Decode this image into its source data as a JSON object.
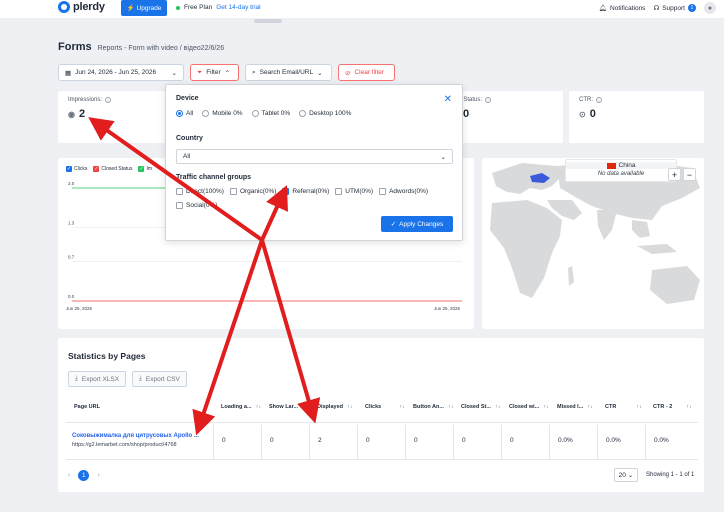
{
  "brand": {
    "name": "plerdy",
    "color": "#1a73e8"
  },
  "topbar": {
    "upgrade_label": "Upgrade",
    "plan_label": "Free Plan",
    "trial_link": "Get 14-day trial",
    "notifications_label": "Notifications",
    "support_label": "Support",
    "support_badge": "1"
  },
  "header": {
    "title": "Forms",
    "breadcrumb": "Reports - Form with video / відео22/6/26"
  },
  "controls": {
    "date_range": "Jun 24, 2026 - Jun 25, 2026",
    "filter_label": "Filter",
    "search_label": "Search Email/URL",
    "clear_filter_label": "Clear filter"
  },
  "stats": {
    "impressions_label": "Impressions:",
    "impressions_value": "2",
    "closed_status_label": "ed Status:",
    "closed_status_value": "0",
    "ctr_label": "CTR:",
    "ctr_value": "0"
  },
  "line_chart": {
    "legend": [
      {
        "label": "Clicks",
        "color": "#1a73e8"
      },
      {
        "label": "Closed Status",
        "color": "#ef4444"
      },
      {
        "label": "Im",
        "color": "#22c55e"
      }
    ]
  },
  "chart_data": {
    "type": "line",
    "x": [
      "Jun 25, 2026",
      "Jun 25, 2026"
    ],
    "ylim": [
      0,
      2.0
    ],
    "yticks": [
      "2.0",
      "1.3",
      "0.7",
      "0.0"
    ],
    "series": [
      {
        "name": "Impressions",
        "color": "#22c55e",
        "values": [
          2,
          2
        ]
      },
      {
        "name": "Closed Status",
        "color": "#ef4444",
        "values": [
          0,
          0
        ]
      }
    ]
  },
  "map": {
    "country": "China",
    "no_data": "No data available",
    "zoom_in": "+",
    "zoom_out": "−"
  },
  "stats_table": {
    "title": "Statistics by Pages",
    "export_xlsx": "Export XLSX",
    "export_csv": "Export CSV",
    "columns": [
      "Page URL",
      "Loading a...",
      "Show Lar...",
      "Displayed",
      "Clicks",
      "Button An...",
      "Closed St...",
      "Closed wi...",
      "Missed I...",
      "CTR",
      "CTR - 2"
    ],
    "rows": [
      {
        "page_title": "Соковыжималка для цитрусовых Apollo ...",
        "page_url": "https://g2.lemarbet.com/shop/product/4768",
        "values": [
          "0",
          "0",
          "2",
          "0",
          "0",
          "0",
          "0",
          "0.0%",
          "0.0%",
          "0.0%"
        ]
      }
    ],
    "current_page": "1",
    "per_page": "20",
    "showing": "Showing 1 - 1 of 1"
  },
  "filter_popup": {
    "device_heading": "Device",
    "device_options": [
      "All",
      "Mobile 0%",
      "Tablet 0%",
      "Desktop 100%"
    ],
    "device_selected": "All",
    "country_heading": "Country",
    "country_value": "All",
    "traffic_heading": "Traffic channel groups",
    "traffic_row1": [
      {
        "label": "Direct(100%)",
        "checked": false
      },
      {
        "label": "Organic(0%)",
        "checked": false
      },
      {
        "label": "Referral(0%)",
        "checked": true
      },
      {
        "label": "UTM(0%)",
        "checked": false
      },
      {
        "label": "Adwords(0%)",
        "checked": false
      }
    ],
    "traffic_row2": [
      {
        "label": "Social(0%)",
        "checked": false
      }
    ],
    "apply_label": "Apply Changes"
  },
  "annotation_color": "#e11d1d"
}
